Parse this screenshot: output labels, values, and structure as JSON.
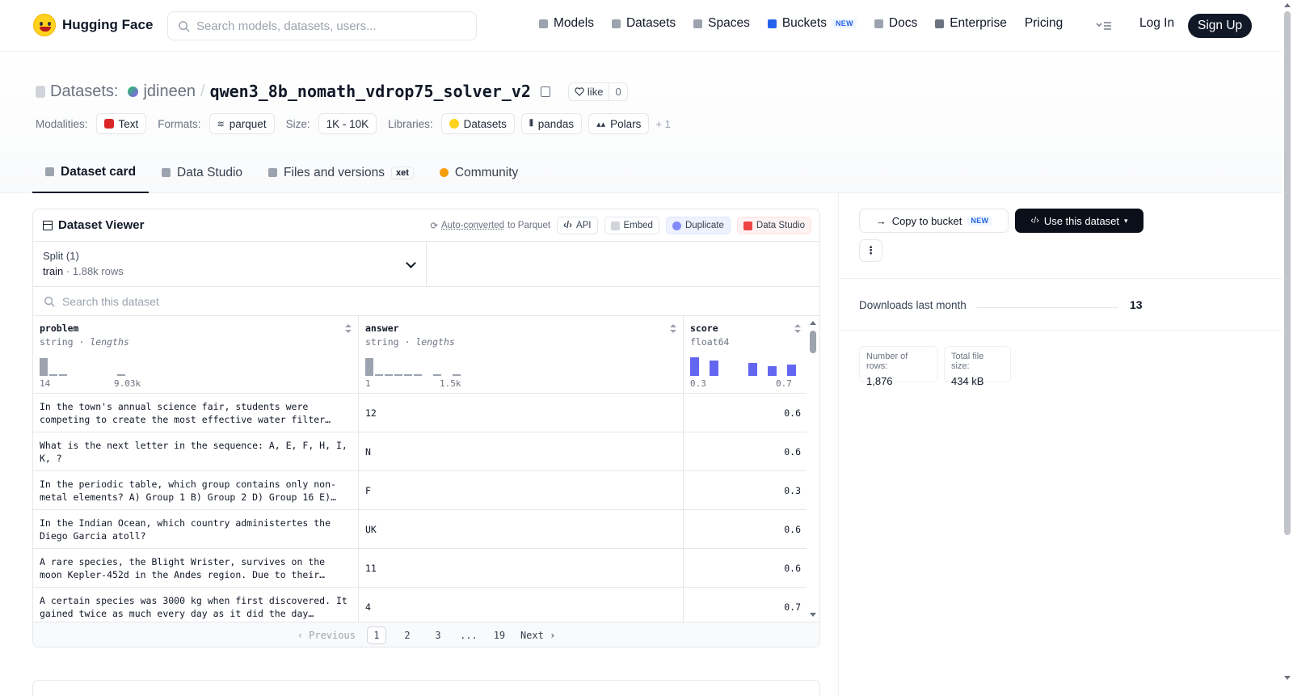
{
  "nav": {
    "brand": "Hugging Face",
    "search_placeholder": "Search models, datasets, users...",
    "links": [
      {
        "label": "Models",
        "icon": "models-icon",
        "color": "#9ca3af"
      },
      {
        "label": "Datasets",
        "icon": "datasets-icon",
        "color": "#9ca3af"
      },
      {
        "label": "Spaces",
        "icon": "spaces-icon",
        "color": "#9ca3af"
      },
      {
        "label": "Buckets",
        "icon": "buckets-icon",
        "color": "#2563eb",
        "badge": "NEW"
      },
      {
        "label": "Docs",
        "icon": "docs-icon",
        "color": "#9ca3af"
      },
      {
        "label": "Enterprise",
        "icon": "enterprise-icon",
        "color": "#6b7280"
      },
      {
        "label": "Pricing"
      }
    ],
    "login": "Log In",
    "signup": "Sign Up"
  },
  "repo": {
    "prefix": "Datasets:",
    "user": "jdineen",
    "separator": "/",
    "name": "qwen3_8b_nomath_vdrop75_solver_v2",
    "like_label": "like",
    "like_count": "0"
  },
  "tags": {
    "modalities_label": "Modalities:",
    "modalities": [
      "Text"
    ],
    "formats_label": "Formats:",
    "formats": [
      "parquet"
    ],
    "size_label": "Size:",
    "size": "1K - 10K",
    "libraries_label": "Libraries:",
    "libraries": [
      "Datasets",
      "pandas",
      "Polars"
    ],
    "more": "+ 1"
  },
  "tabs": [
    {
      "label": "Dataset card",
      "active": true
    },
    {
      "label": "Data Studio"
    },
    {
      "label": "Files and versions",
      "badge": "xet"
    },
    {
      "label": "Community"
    }
  ],
  "viewer": {
    "title": "Dataset Viewer",
    "auto_converted_link": "Auto-converted",
    "auto_converted_rest": "to Parquet",
    "api": "API",
    "embed": "Embed",
    "duplicate": "Duplicate",
    "data_studio": "Data Studio",
    "split_label": "Split (1)",
    "split_name": "train",
    "split_rows": "1.88k rows",
    "search_placeholder": "Search this dataset",
    "columns": [
      {
        "name": "problem",
        "type": "string",
        "stat": "lengths",
        "min": "14",
        "max": "9.03k",
        "hist": [
          0.85,
          0.08,
          0.08,
          0,
          0,
          0,
          0,
          0,
          0.05
        ],
        "color": "#9ca3af"
      },
      {
        "name": "answer",
        "type": "string",
        "stat": "lengths",
        "min": "1",
        "max": "1.5k",
        "hist": [
          0.85,
          0.06,
          0.06,
          0.06,
          0.06,
          0.06,
          0,
          0.06,
          0,
          0.06
        ],
        "color": "#9ca3af"
      },
      {
        "name": "score",
        "type": "float64",
        "min": "0.3",
        "max": "0.7",
        "hist": [
          0.9,
          0.72,
          0,
          0.62,
          0.48,
          0.52
        ],
        "color": "#6366f1"
      }
    ],
    "rows": [
      {
        "problem": "In the town's annual science fair, students were competing to create the most effective water filter…",
        "answer": "12",
        "score": "0.6"
      },
      {
        "problem": "What is the next letter in the sequence: A, E, F, H, I, K, ?",
        "answer": "N",
        "score": "0.6"
      },
      {
        "problem": "In the periodic table, which group contains only non-metal elements? A) Group 1 B) Group 2 D) Group 16 E)…",
        "answer": "F",
        "score": "0.3"
      },
      {
        "problem": "In the Indian Ocean, which country administertes the Diego Garcia atoll?",
        "answer": "UK",
        "score": "0.6"
      },
      {
        "problem": "A rare species, the Blight Wrister, survives on the moon Kepler-452d in the Andes region. Due to their…",
        "answer": "11",
        "score": "0.6"
      },
      {
        "problem": "A certain species was 3000 kg when first discovered. It gained twice as much every day as it did the day…",
        "answer": "4",
        "score": "0.7"
      }
    ],
    "pager": {
      "prev": "Previous",
      "pages": [
        "1",
        "2",
        "3",
        "...",
        "19"
      ],
      "next": "Next",
      "current": "1"
    }
  },
  "sidebar": {
    "copy_bucket": "Copy to bucket",
    "copy_badge": "NEW",
    "use_dataset": "Use this dataset",
    "downloads_label": "Downloads last month",
    "downloads_value": "13",
    "rows_label": "Number of rows:",
    "rows_value": "1,876",
    "size_label": "Total file size:",
    "size_value": "434 kB"
  }
}
